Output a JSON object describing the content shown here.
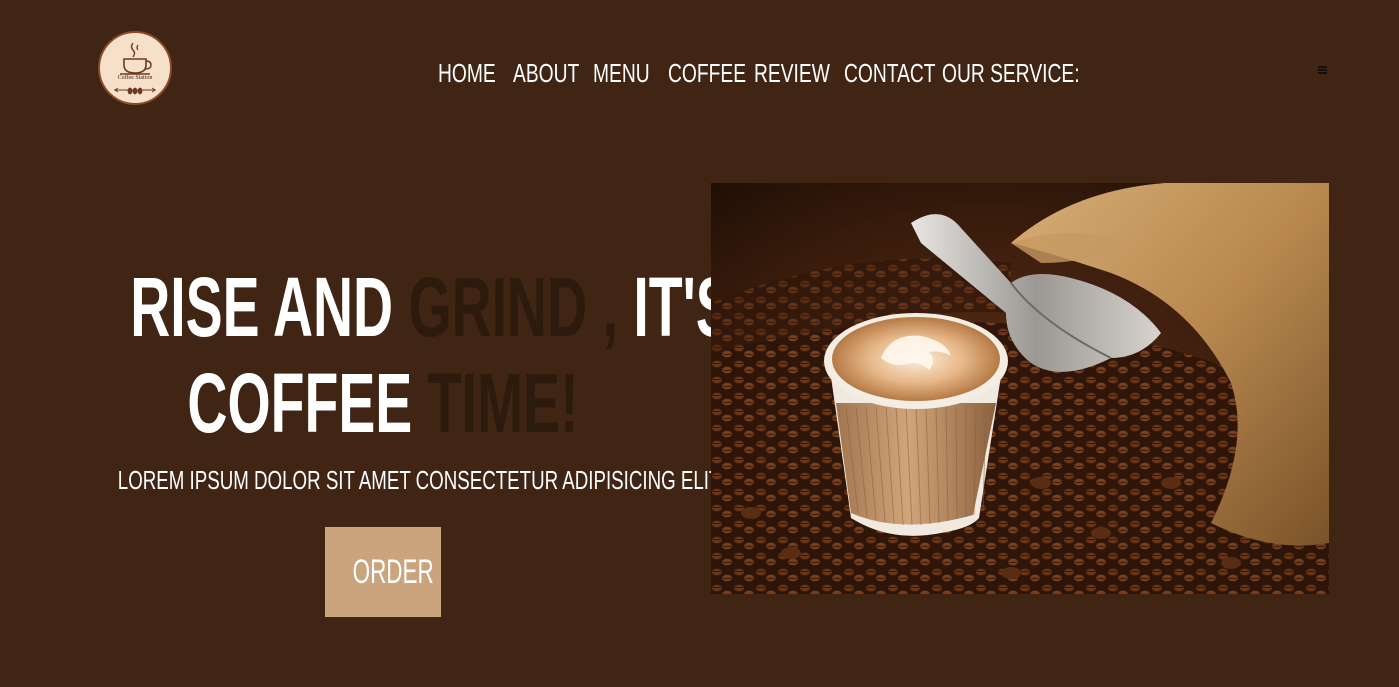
{
  "logo": {
    "icon": "coffee-cup-icon",
    "text": "Coffee Station"
  },
  "nav": {
    "items": [
      {
        "label": "HOME"
      },
      {
        "label": "ABOUT"
      },
      {
        "label": "MENU"
      },
      {
        "label": "COFFEE"
      },
      {
        "label": "REVIEW"
      },
      {
        "label": "CONTACT"
      },
      {
        "label": "OUR SERVICE:"
      }
    ],
    "menu_icon": "hamburger-menu-icon"
  },
  "hero": {
    "title_line1_a": "RISE AND ",
    "title_line1_b": "GRIND , ",
    "title_line1_c": "IT'S",
    "title_line2_a": "COFFEE ",
    "title_line2_b": "TIME!",
    "subtitle": "LOREM IPSUM DOLOR SIT AMET CONSECTETUR ADIPISICING ELIT.",
    "cta_label": "ORDER IT",
    "image_icon": "coffee-cup-with-beans-image"
  },
  "colors": {
    "background": "#402515",
    "accent_dark_text": "#2c1a0d",
    "button": "#c9a47d",
    "logo_bg": "#f7e0c9"
  }
}
